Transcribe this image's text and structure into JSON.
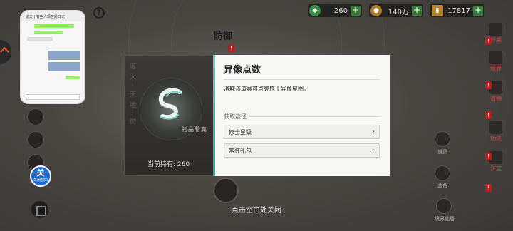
{
  "currencies": [
    {
      "icon": "green-coin-icon",
      "value": "260",
      "color": "#3a8a4a"
    },
    {
      "icon": "gold-coin-icon",
      "value": "140万",
      "color": "#b07a2a"
    },
    {
      "icon": "scroll-icon",
      "value": "17817",
      "color": "#b4862e"
    }
  ],
  "scene": {
    "help_glyph": "?",
    "defense_label": "防御",
    "close_hint": "点击空白处关闭"
  },
  "chat_thumb": {
    "header_text": "道天 | 有些人现在是日记"
  },
  "float_ball": {
    "main": "关",
    "sub": "关闭窗口"
  },
  "right_menu": [
    {
      "name": "opportunity",
      "label": "开采"
    },
    {
      "name": "realm",
      "label": "境界"
    },
    {
      "name": "item",
      "label": "道物"
    },
    {
      "name": "fortune",
      "label": "功法"
    },
    {
      "name": "treasure",
      "label": "法宝"
    }
  ],
  "bottom_buttons": [
    {
      "label": "道具"
    },
    {
      "label": "装备"
    },
    {
      "label": "境界仙居"
    }
  ],
  "modal": {
    "title": "异像点数",
    "description": "消耗该道具可点亮修士异像星图。",
    "section_heading": "获取途径",
    "sources": [
      {
        "label": "修士星级"
      },
      {
        "label": "常驻礼包"
      }
    ],
    "emblem_caption": "物品着真",
    "held_text": "当前持有: 260",
    "vertical_text": "道人·天地·时"
  },
  "accent_colors": {
    "teal": "#5fbfa5",
    "alert_red": "#b51e1e",
    "brand_blue": "#1c6ed6"
  }
}
